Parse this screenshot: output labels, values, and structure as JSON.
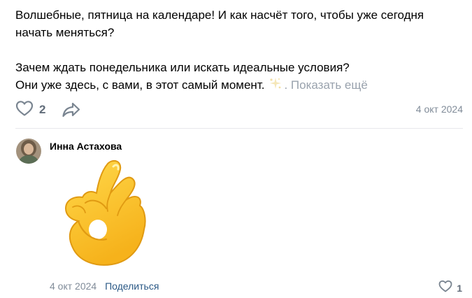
{
  "post": {
    "line1": "Волшебные, пятница на календаре! И как насчёт того, чтобы уже сегодня",
    "line2": "начать меняться?",
    "line3": "Зачем ждать понедельника или искать идеальные условия?",
    "line4": "Они уже здесь, с вами, в этот самый момент.",
    "show_more": "Показать ещё",
    "dot": ".",
    "sparkle_icon": "sparkle-emoji",
    "likes": "2",
    "date": "4 окт 2024",
    "colors": {
      "muted": "#818c99",
      "link": "#2a5885",
      "divider": "#e7e8ec"
    }
  },
  "comment": {
    "author": "Инна Астахова",
    "sticker": "ok-hand-emoji",
    "date": "4 окт 2024",
    "share_label": "Поделиться",
    "likes": "1"
  }
}
